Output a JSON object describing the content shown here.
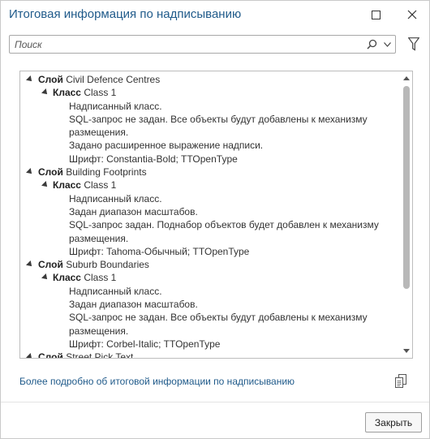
{
  "window": {
    "title": "Итоговая информация по надписыванию"
  },
  "search": {
    "placeholder": "Поиск",
    "value": ""
  },
  "tree": {
    "rows": [
      {
        "level": 0,
        "kw": "Слой",
        "text": "Civil Defence Centres"
      },
      {
        "level": 1,
        "kw": "Класс",
        "text": "Class 1"
      },
      {
        "level": 2,
        "kw": "",
        "text": "Надписанный класс."
      },
      {
        "level": 2,
        "kw": "",
        "text": "SQL-запрос не задан. Все объекты будут добавлены к механизму"
      },
      {
        "level": 2,
        "kw": "",
        "text": "размещения."
      },
      {
        "level": 2,
        "kw": "",
        "text": "Задано расширенное выражение надписи."
      },
      {
        "level": 2,
        "kw": "",
        "text": "Шрифт: Constantia-Bold; TTOpenType"
      },
      {
        "level": 0,
        "kw": "Слой",
        "text": "Building Footprints"
      },
      {
        "level": 1,
        "kw": "Класс",
        "text": "Class 1"
      },
      {
        "level": 2,
        "kw": "",
        "text": "Надписанный класс."
      },
      {
        "level": 2,
        "kw": "",
        "text": "Задан диапазон масштабов."
      },
      {
        "level": 2,
        "kw": "",
        "text": "SQL-запрос задан. Поднабор объектов будет добавлен к механизму"
      },
      {
        "level": 2,
        "kw": "",
        "text": "размещения."
      },
      {
        "level": 2,
        "kw": "",
        "text": "Шрифт: Tahoma-Обычный; TTOpenType"
      },
      {
        "level": 0,
        "kw": "Слой",
        "text": "Suburb Boundaries"
      },
      {
        "level": 1,
        "kw": "Класс",
        "text": "Class 1"
      },
      {
        "level": 2,
        "kw": "",
        "text": "Надписанный класс."
      },
      {
        "level": 2,
        "kw": "",
        "text": "Задан диапазон масштабов."
      },
      {
        "level": 2,
        "kw": "",
        "text": "SQL-запрос не задан. Все объекты будут добавлены к механизму"
      },
      {
        "level": 2,
        "kw": "",
        "text": "размещения."
      },
      {
        "level": 2,
        "kw": "",
        "text": "Шрифт: Corbel-Italic; TTOpenType"
      },
      {
        "level": 0,
        "kw": "Слой",
        "text": "Street Pick Text"
      }
    ]
  },
  "footer": {
    "help_link": "Более подробно об итоговой информации по надписыванию",
    "close_label": "Закрыть"
  },
  "icons": {
    "maximize": "maximize-icon",
    "close": "close-icon",
    "search": "search-icon",
    "dropdown": "chevron-down-icon",
    "filter": "filter-icon",
    "copy": "copy-icon",
    "expand": "expand-triangle-icon"
  },
  "colors": {
    "title": "#1f5a8a",
    "link": "#1f5a8a",
    "scroll_thumb": "#b8b8b8"
  }
}
